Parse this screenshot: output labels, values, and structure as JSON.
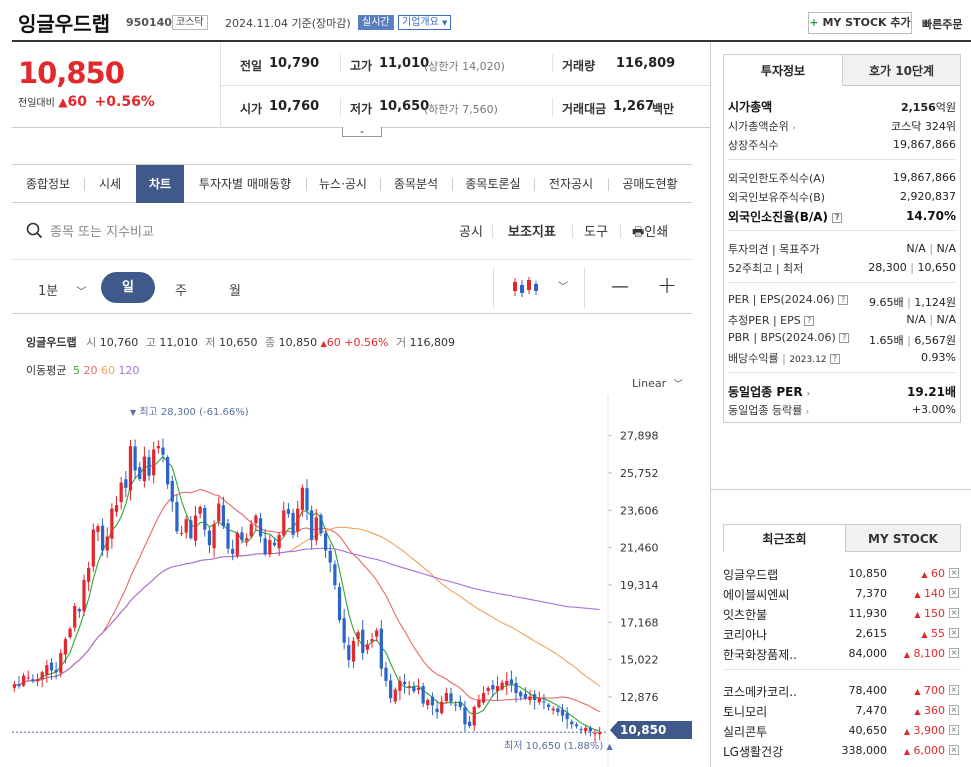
{
  "header": {
    "stock_name": "잉글우드랩",
    "stock_code": "950140",
    "market_tag": "코스닥",
    "date_text": "2024.11.04  기준(장마감)",
    "realtime_tag": "실시간",
    "company_tag": "기업개요",
    "my_stock_button": "MY STOCK 추가",
    "quick_order": "빠른주문"
  },
  "price": {
    "current": "10,850",
    "change_label": "전일대비",
    "change_amount": "60",
    "change_pct": "+0.56%",
    "prev_label": "전일",
    "prev": "10,790",
    "high_label": "고가",
    "high": "11,010",
    "high_sub": "(상한가 14,020)",
    "volume_label": "거래량",
    "volume": "116,809",
    "open_label": "시가",
    "open": "10,760",
    "low_label": "저가",
    "low": "10,650",
    "low_sub": "(하한가 7,560)",
    "amount_label": "거래대금",
    "amount": "1,267",
    "amount_unit": "백만"
  },
  "tabs": [
    "종합정보",
    "시세",
    "차트",
    "투자자별 매매동향",
    "뉴스·공시",
    "종목분석",
    "종목토론실",
    "전자공시",
    "공매도현황"
  ],
  "toolbar": {
    "search_placeholder": "종목 또는 지수비교",
    "disclosure": "공시",
    "indicator": "보조지표",
    "tools": "도구",
    "print": "인쇄"
  },
  "periods": {
    "minute": "1분",
    "day": "일",
    "week": "주",
    "month": "월"
  },
  "chart_info": {
    "name": "잉글우드랩",
    "open_label": "시",
    "open": "10,760",
    "high_label": "고",
    "high": "11,010",
    "low_label": "저",
    "low": "10,650",
    "close_label": "종",
    "close": "10,850",
    "change": "60",
    "pct": "+0.56%",
    "vol_label": "거",
    "vol": "116,809",
    "ma_label": "이동평균",
    "ma": [
      "5",
      "20",
      "60",
      "120"
    ],
    "scale": "Linear",
    "max_label": "최고 28,300 (-61.66%)",
    "min_label": "최저 10,650 (1.88%)",
    "current_tag": "10,850"
  },
  "chart_data": {
    "type": "candlestick",
    "y_ticks": [
      "27,898",
      "25,752",
      "23,606",
      "21,460",
      "19,314",
      "17,168",
      "15,022",
      "12,876"
    ],
    "ylim": [
      10400,
      29200
    ],
    "close": [
      13600,
      13500,
      14100,
      14000,
      13800,
      13900,
      14300,
      14700,
      14400,
      14300,
      15400,
      16200,
      16800,
      18100,
      17800,
      19600,
      20300,
      22500,
      22700,
      21300,
      22100,
      23700,
      23900,
      25200,
      24900,
      27300,
      25900,
      25400,
      26700,
      25600,
      27100,
      27300,
      26800,
      25100,
      24100,
      22400,
      22300,
      23100,
      22000,
      23300,
      23800,
      22500,
      21600,
      22800,
      24000,
      22700,
      21400,
      21100,
      22300,
      21900,
      22000,
      22800,
      23300,
      22100,
      21100,
      21900,
      21600,
      22200,
      23600,
      23400,
      22200,
      23700,
      24900,
      23600,
      21900,
      23200,
      22300,
      21300,
      20600,
      19300,
      17300,
      16000,
      15000,
      16100,
      16600,
      15400,
      15900,
      16200,
      16700,
      14500,
      13800,
      12800,
      13300,
      13800,
      13600,
      13500,
      13200,
      13400,
      12500,
      12700,
      12400,
      12000,
      12600,
      13100,
      12600,
      12400,
      12300,
      11300,
      11200,
      12300,
      12700,
      13100,
      13400,
      13300,
      13500,
      13700,
      13800,
      13600,
      13100,
      12900,
      12800,
      12900,
      12700,
      12800,
      12600,
      12300,
      12200,
      12000,
      11800,
      11600,
      11300,
      11200,
      11000,
      11100,
      10900,
      10790,
      10850
    ],
    "ma_series": [
      {
        "name": "5",
        "color": "#33a533"
      },
      {
        "name": "20",
        "color": "#e96868"
      },
      {
        "name": "60",
        "color": "#f0a25a"
      },
      {
        "name": "120",
        "color": "#a872d8"
      }
    ],
    "grid": false
  },
  "right": {
    "tab_invest": "투자정보",
    "tab_quote": "호가 10단계",
    "market_cap_label": "시가총액",
    "market_cap": "2,156",
    "market_cap_unit": "억원",
    "rank_label": "시가총액순위",
    "rank": "코스닥 324위",
    "shares_label": "상장주식수",
    "shares": "19,867,866",
    "foreign_limit_label": "외국인한도주식수(A)",
    "foreign_limit": "19,867,866",
    "foreign_own_label": "외국인보유주식수(B)",
    "foreign_own": "2,920,837",
    "foreign_ratio_label": "외국인소진율(B/A)",
    "foreign_ratio": "14.70%",
    "opinion_label": "투자의견 | 목표주가",
    "opinion": "N/A",
    "target": "N/A",
    "w52_label": "52주최고 | 최저",
    "w52_high": "28,300",
    "w52_low": "10,650",
    "per_label": "PER | EPS(2024.06)",
    "per": "9.65배",
    "eps": "1,124원",
    "est_label": "추정PER | EPS",
    "est_per": "N/A",
    "est_eps": "N/A",
    "pbr_label": "PBR | BPS(2024.06)",
    "pbr": "1.65배",
    "bps": "6,567원",
    "div_label": "배당수익률",
    "div_date": "2023.12",
    "div": "0.93%",
    "sector_per_label": "동일업종 PER",
    "sector_per": "19.21배",
    "sector_chg_label": "동일업종 등락률",
    "sector_chg": "+3.00%",
    "tab_recent": "최근조회",
    "tab_mystock": "MY STOCK",
    "recent": [
      {
        "name": "잉글우드랩",
        "price": "10,850",
        "chg": "60"
      },
      {
        "name": "에이블씨엔씨",
        "price": "7,370",
        "chg": "140"
      },
      {
        "name": "잇츠한불",
        "price": "11,930",
        "chg": "150"
      },
      {
        "name": "코리아나",
        "price": "2,615",
        "chg": "55"
      },
      {
        "name": "한국화장품제..",
        "price": "84,000",
        "chg": "8,100"
      },
      {
        "name": "코스메카코리..",
        "price": "78,400",
        "chg": "700"
      },
      {
        "name": "토니모리",
        "price": "7,470",
        "chg": "360"
      },
      {
        "name": "실리콘투",
        "price": "40,650",
        "chg": "3,900"
      },
      {
        "name": "LG생활건강",
        "price": "338,000",
        "chg": "6,000"
      }
    ]
  }
}
